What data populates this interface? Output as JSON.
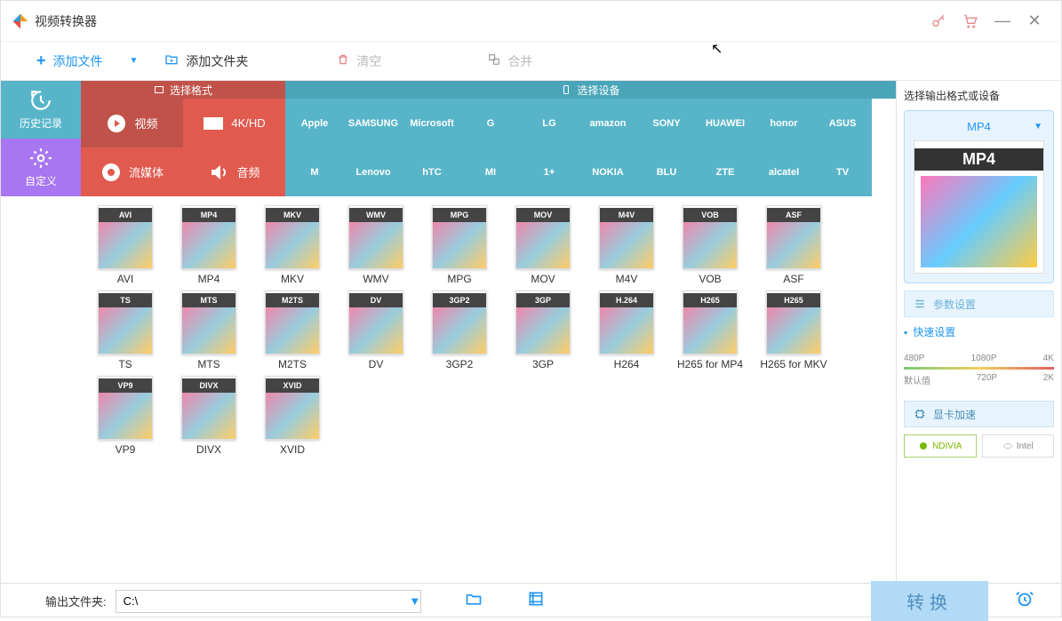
{
  "app": {
    "title": "视频转换器"
  },
  "toolbar": {
    "add_file": "添加文件",
    "add_folder": "添加文件夹",
    "clear": "清空",
    "merge": "合并"
  },
  "sidebar": {
    "history": "历史记录",
    "custom": "自定义"
  },
  "tabs": {
    "select_format": "选择格式",
    "select_device": "选择设备"
  },
  "categories": {
    "video": "视频",
    "fourk": "4K/HD",
    "stream": "流媒体",
    "audio": "音频"
  },
  "brands": [
    "Apple",
    "SAMSUNG",
    "Microsoft",
    "G",
    "LG",
    "amazon",
    "SONY",
    "HUAWEI",
    "honor",
    "ASUS",
    "M",
    "Lenovo",
    "hTC",
    "MI",
    "1+",
    "NOKIA",
    "BLU",
    "ZTE",
    "alcatel",
    "TV"
  ],
  "formats": [
    {
      "code": "AVI",
      "name": "AVI"
    },
    {
      "code": "MP4",
      "name": "MP4"
    },
    {
      "code": "MKV",
      "name": "MKV"
    },
    {
      "code": "WMV",
      "name": "WMV"
    },
    {
      "code": "MPG",
      "name": "MPG"
    },
    {
      "code": "MOV",
      "name": "MOV"
    },
    {
      "code": "M4V",
      "name": "M4V"
    },
    {
      "code": "VOB",
      "name": "VOB"
    },
    {
      "code": "ASF",
      "name": "ASF"
    },
    {
      "code": "TS",
      "name": "TS"
    },
    {
      "code": "MTS",
      "name": "MTS"
    },
    {
      "code": "M2TS",
      "name": "M2TS"
    },
    {
      "code": "DV",
      "name": "DV"
    },
    {
      "code": "3GP2",
      "name": "3GP2"
    },
    {
      "code": "3GP",
      "name": "3GP"
    },
    {
      "code": "H.264",
      "name": "H264"
    },
    {
      "code": "H265",
      "name": "H265 for MP4"
    },
    {
      "code": "H265",
      "name": "H265 for MKV"
    },
    {
      "code": "VP9",
      "name": "VP9"
    },
    {
      "code": "DIVX",
      "name": "DIVX"
    },
    {
      "code": "XVID",
      "name": "XVID"
    }
  ],
  "right": {
    "title": "选择输出格式或设备",
    "preview_format": "MP4",
    "preview_label": "MP4",
    "params": "参数设置",
    "quick": "快速设置",
    "res_top": [
      "480P",
      "1080P",
      "4K"
    ],
    "res_bot_left": "默认值",
    "res_bot": [
      "720P",
      "2K"
    ],
    "gpu": "显卡加速",
    "nvidia": "NDIVIA",
    "intel": "Intel"
  },
  "bottom": {
    "out_label": "输出文件夹:",
    "out_path": "C:\\",
    "convert": "转换"
  }
}
